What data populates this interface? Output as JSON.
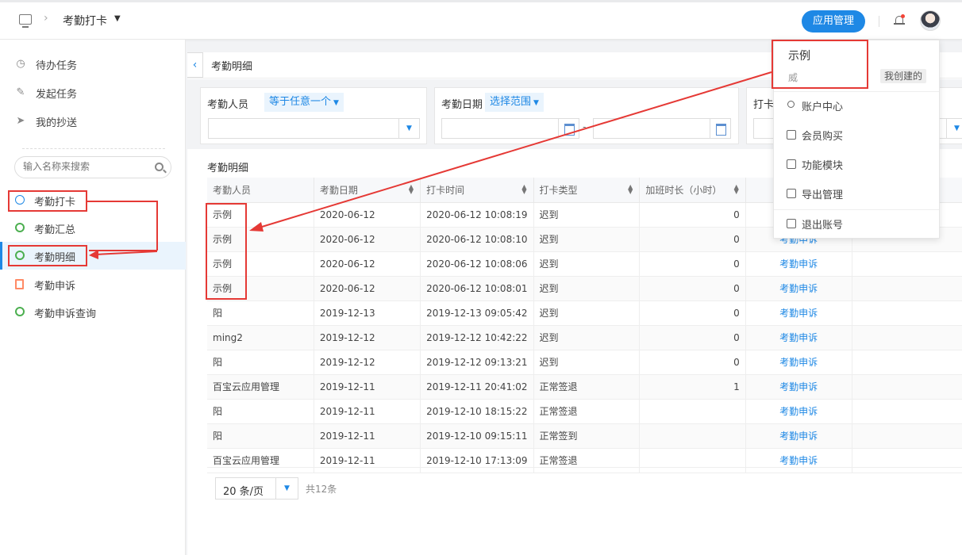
{
  "topbar": {
    "title": "考勤打卡",
    "app_button": "应用管理"
  },
  "sidebar": {
    "menu": [
      {
        "label": "待办任务",
        "icon": "clock-icon"
      },
      {
        "label": "发起任务",
        "icon": "edit-icon"
      },
      {
        "label": "我的抄送",
        "icon": "send-icon"
      }
    ],
    "search_placeholder": "输入名称来搜索",
    "apps": [
      {
        "label": "考勤打卡",
        "icon": "clock-icon"
      },
      {
        "label": "考勤汇总",
        "icon": "circle-icon"
      },
      {
        "label": "考勤明细",
        "icon": "circle-icon"
      },
      {
        "label": "考勤申诉",
        "icon": "document-icon"
      },
      {
        "label": "考勤申诉查询",
        "icon": "circle-icon"
      }
    ]
  },
  "main": {
    "crumb": "考勤明细",
    "filters": [
      {
        "label": "考勤人员",
        "op": "等于任意一个"
      },
      {
        "label": "考勤日期",
        "op": "选择范围",
        "sep": "-"
      },
      {
        "label": "打卡"
      }
    ],
    "table_title": "考勤明细",
    "columns": [
      "考勤人员",
      "考勤日期",
      "打卡时间",
      "打卡类型",
      "加班时长（小时）",
      ""
    ],
    "rows": [
      [
        "示例",
        "2020-06-12",
        "2020-06-12 10:08:19",
        "迟到",
        "0",
        ""
      ],
      [
        "示例",
        "2020-06-12",
        "2020-06-12 10:08:10",
        "迟到",
        "0",
        "考勤申诉"
      ],
      [
        "示例",
        "2020-06-12",
        "2020-06-12 10:08:06",
        "迟到",
        "0",
        "考勤申诉"
      ],
      [
        "示例",
        "2020-06-12",
        "2020-06-12 10:08:01",
        "迟到",
        "0",
        "考勤申诉"
      ],
      [
        "阳",
        "2019-12-13",
        "2019-12-13 09:05:42",
        "迟到",
        "0",
        "考勤申诉"
      ],
      [
        "ming2",
        "2019-12-12",
        "2019-12-12 10:42:22",
        "迟到",
        "0",
        "考勤申诉"
      ],
      [
        "阳",
        "2019-12-12",
        "2019-12-12 09:13:21",
        "迟到",
        "0",
        "考勤申诉"
      ],
      [
        "百宝云应用管理",
        "2019-12-11",
        "2019-12-11 20:41:02",
        "正常签退",
        "1",
        "考勤申诉"
      ],
      [
        "阳",
        "2019-12-11",
        "2019-12-10 18:15:22",
        "正常签退",
        "",
        "考勤申诉"
      ],
      [
        "阳",
        "2019-12-11",
        "2019-12-10 09:15:11",
        "正常签到",
        "",
        "考勤申诉"
      ],
      [
        "百宝云应用管理",
        "2019-12-11",
        "2019-12-10 17:13:09",
        "正常签退",
        "",
        "考勤申诉"
      ]
    ],
    "page_size": "20 条/页",
    "total": "共12条"
  },
  "user_menu": {
    "name": "示例",
    "sub": "威",
    "tag": "我创建的",
    "items": [
      {
        "label": "账户中心",
        "icon": "user-icon"
      },
      {
        "label": "会员购买",
        "icon": "bag-icon"
      },
      {
        "label": "功能模块",
        "icon": "puzzle-icon"
      },
      {
        "label": "导出管理",
        "icon": "download-icon"
      },
      {
        "label": "退出账号",
        "icon": "logout-icon"
      }
    ]
  },
  "colors": {
    "accent": "#1e88e5",
    "annotation": "#e53935"
  }
}
